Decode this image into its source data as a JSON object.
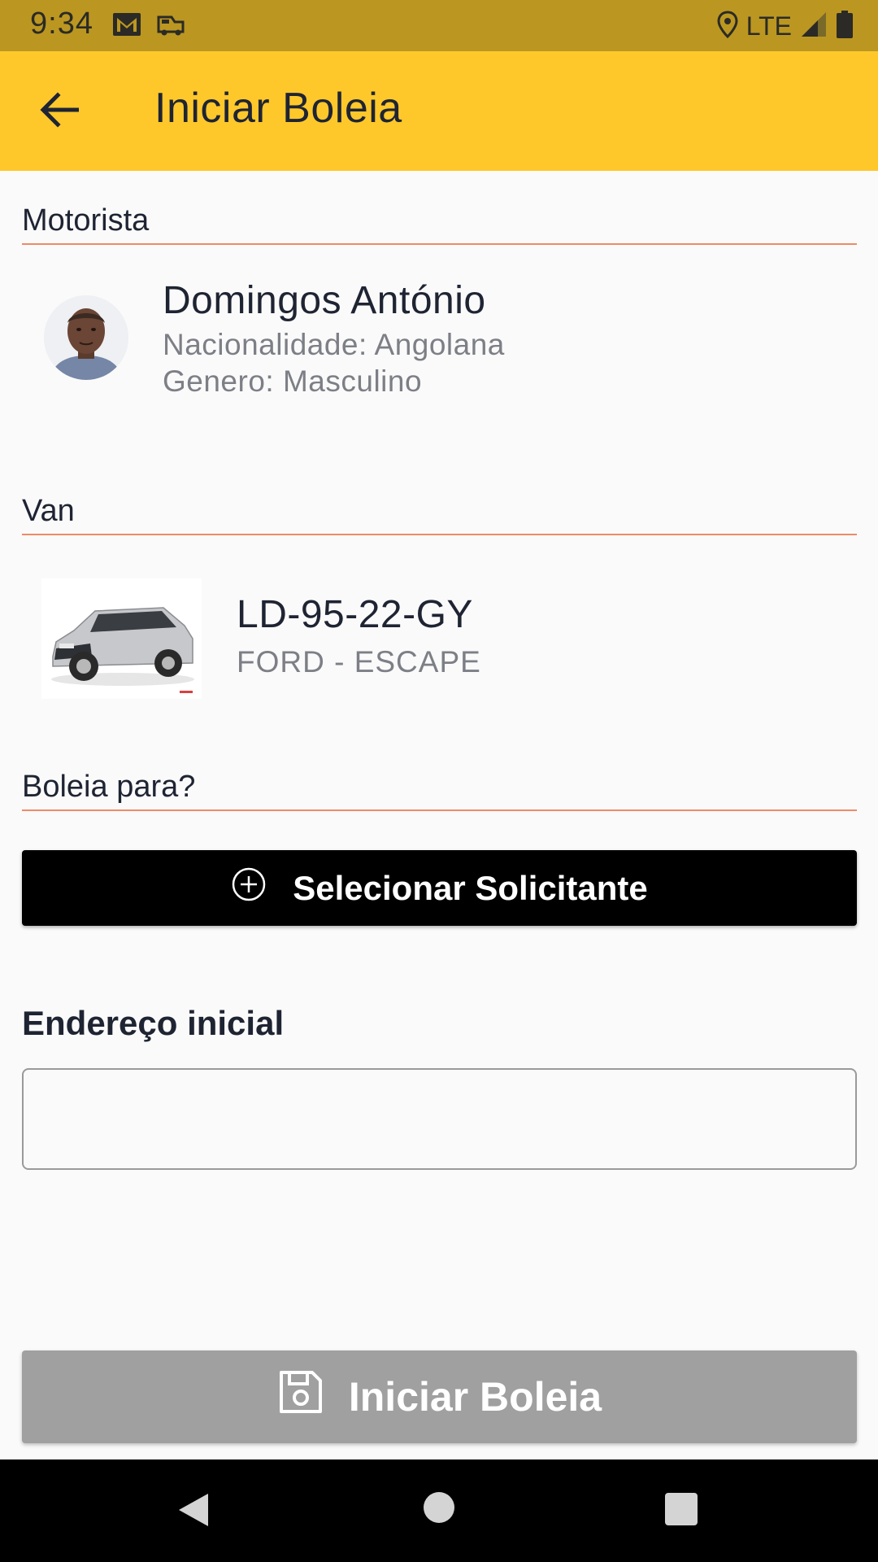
{
  "status_bar": {
    "time": "9:34",
    "network": "LTE",
    "icons": [
      "gmail-icon",
      "car-icon",
      "location-icon",
      "signal-icon",
      "battery-icon"
    ]
  },
  "app_bar": {
    "title": "Iniciar Boleia",
    "back_icon": "arrow-left-icon",
    "color": "#fec82b"
  },
  "driver_section": {
    "header": "Motorista",
    "name": "Domingos António",
    "nationality": "Nacionalidade: Angolana",
    "gender": "Genero: Masculino"
  },
  "van_section": {
    "header": "Van",
    "plate": "LD-95-22-GY",
    "model": "FORD - ESCAPE"
  },
  "ride_section": {
    "header": "Boleia para?",
    "select_button_label": "Selecionar Solicitante",
    "select_icon": "plus-circle-icon"
  },
  "address": {
    "label": "Endereço inicial",
    "value": "",
    "placeholder": ""
  },
  "start_button": {
    "label": "Iniciar Boleia",
    "icon": "save-icon",
    "state": "disabled"
  },
  "colors": {
    "accent": "#fec82b",
    "status_bar": "#bb9721",
    "divider": "#ef8a67",
    "disabled_button": "#a0a0a0"
  }
}
